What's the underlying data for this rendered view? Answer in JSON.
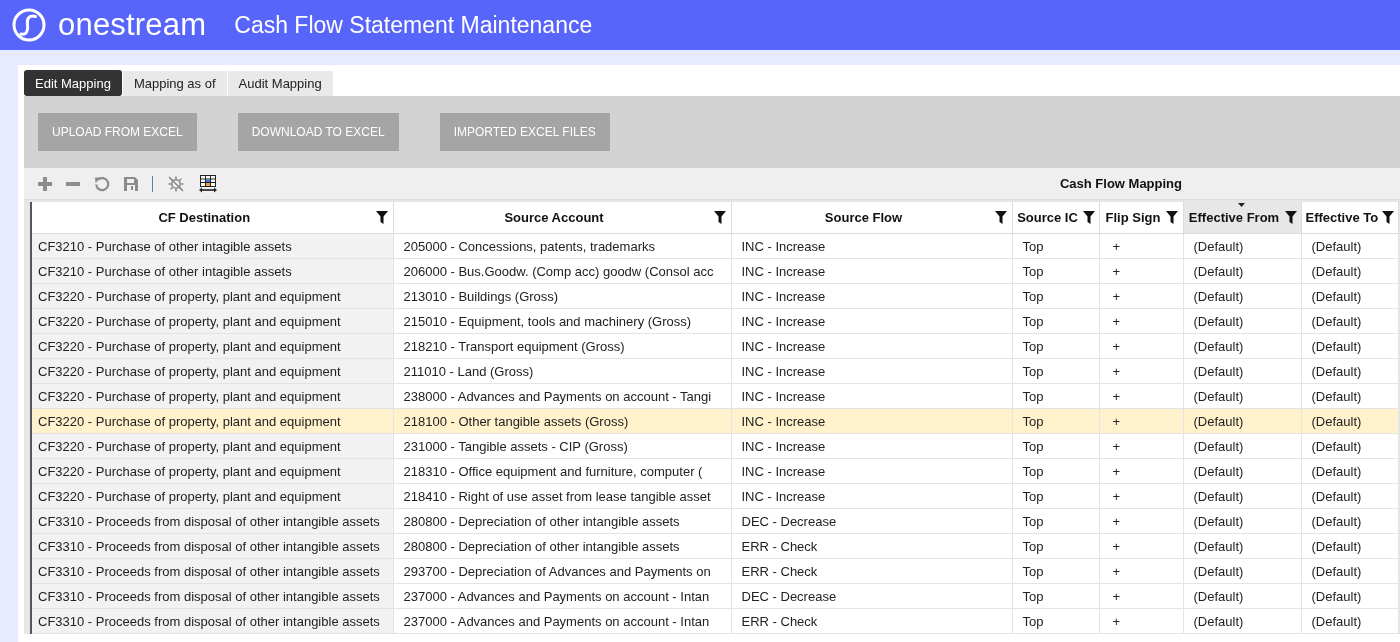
{
  "header": {
    "brand": "onestream",
    "title": "Cash Flow Statement Maintenance"
  },
  "tabs": [
    {
      "label": "Edit Mapping",
      "selected": true
    },
    {
      "label": "Mapping as of",
      "selected": false
    },
    {
      "label": "Audit Mapping",
      "selected": false
    }
  ],
  "action_buttons": [
    {
      "label": "UPLOAD FROM EXCEL"
    },
    {
      "label": "DOWNLOAD TO EXCEL"
    },
    {
      "label": "IMPORTED EXCEL FILES"
    }
  ],
  "grid": {
    "title": "Cash Flow Mapping",
    "columns": [
      {
        "label": "CF Destination",
        "sorted": false
      },
      {
        "label": "Source Account",
        "sorted": false
      },
      {
        "label": "Source Flow",
        "sorted": false
      },
      {
        "label": "Source IC",
        "sorted": false
      },
      {
        "label": "Flip Sign",
        "sorted": false
      },
      {
        "label": "Effective From",
        "sorted": true
      },
      {
        "label": "Effective To",
        "sorted": false
      }
    ],
    "rows": [
      {
        "selected": false,
        "cells": [
          "CF3210 - Purchase of other intagible assets",
          "205000 - Concessions, patents, trademarks",
          "INC - Increase",
          "Top",
          "+",
          "(Default)",
          "(Default)"
        ]
      },
      {
        "selected": false,
        "cells": [
          "CF3210 - Purchase of other intagible assets",
          "206000 - Bus.Goodw. (Comp acc) goodw (Consol acc",
          "INC - Increase",
          "Top",
          "+",
          "(Default)",
          "(Default)"
        ]
      },
      {
        "selected": false,
        "cells": [
          "CF3220 - Purchase of property, plant and equipment",
          "213010 - Buildings (Gross)",
          "INC - Increase",
          "Top",
          "+",
          "(Default)",
          "(Default)"
        ]
      },
      {
        "selected": false,
        "cells": [
          "CF3220 - Purchase of property, plant and equipment",
          "215010 - Equipment, tools and machinery (Gross)",
          "INC - Increase",
          "Top",
          "+",
          "(Default)",
          "(Default)"
        ]
      },
      {
        "selected": false,
        "cells": [
          "CF3220 - Purchase of property, plant and equipment",
          "218210 - Transport equipment (Gross)",
          "INC - Increase",
          "Top",
          "+",
          "(Default)",
          "(Default)"
        ]
      },
      {
        "selected": false,
        "cells": [
          "CF3220 - Purchase of property, plant and equipment",
          "211010 - Land (Gross)",
          "INC - Increase",
          "Top",
          "+",
          "(Default)",
          "(Default)"
        ]
      },
      {
        "selected": false,
        "cells": [
          "CF3220 - Purchase of property, plant and equipment",
          "238000 - Advances and Payments on account - Tangi",
          "INC - Increase",
          "Top",
          "+",
          "(Default)",
          "(Default)"
        ]
      },
      {
        "selected": true,
        "cells": [
          "CF3220 - Purchase of property, plant and equipment",
          "218100 - Other tangible assets (Gross)",
          "INC - Increase",
          "Top",
          "+",
          "(Default)",
          "(Default)"
        ]
      },
      {
        "selected": false,
        "cells": [
          "CF3220 - Purchase of property, plant and equipment",
          "231000 - Tangible assets - CIP (Gross)",
          "INC - Increase",
          "Top",
          "+",
          "(Default)",
          "(Default)"
        ]
      },
      {
        "selected": false,
        "cells": [
          "CF3220 - Purchase of property, plant and equipment",
          "218310 - Office equipment and furniture, computer (",
          "INC - Increase",
          "Top",
          "+",
          "(Default)",
          "(Default)"
        ]
      },
      {
        "selected": false,
        "cells": [
          "CF3220 - Purchase of property, plant and equipment",
          "218410 - Right of use asset from lease tangible asset",
          "INC - Increase",
          "Top",
          "+",
          "(Default)",
          "(Default)"
        ]
      },
      {
        "selected": false,
        "cells": [
          "CF3310 - Proceeds from disposal of other intangible assets",
          "280800 - Depreciation of other intangible assets",
          "DEC - Decrease",
          "Top",
          "+",
          "(Default)",
          "(Default)"
        ]
      },
      {
        "selected": false,
        "cells": [
          "CF3310 - Proceeds from disposal of other intangible assets",
          "280800 - Depreciation of other intangible assets",
          "ERR - Check",
          "Top",
          "+",
          "(Default)",
          "(Default)"
        ]
      },
      {
        "selected": false,
        "cells": [
          "CF3310 - Proceeds from disposal of other intangible assets",
          "293700 - Depreciation of Advances and Payments on",
          "ERR - Check",
          "Top",
          "+",
          "(Default)",
          "(Default)"
        ]
      },
      {
        "selected": false,
        "cells": [
          "CF3310 - Proceeds from disposal of other intangible assets",
          "237000 - Advances and Payments on account - Intan",
          "DEC - Decrease",
          "Top",
          "+",
          "(Default)",
          "(Default)"
        ]
      },
      {
        "selected": false,
        "cells": [
          "CF3310 - Proceeds from disposal of other intangible assets",
          "237000 - Advances and Payments on account - Intan",
          "ERR - Check",
          "Top",
          "+",
          "(Default)",
          "(Default)"
        ]
      }
    ]
  }
}
